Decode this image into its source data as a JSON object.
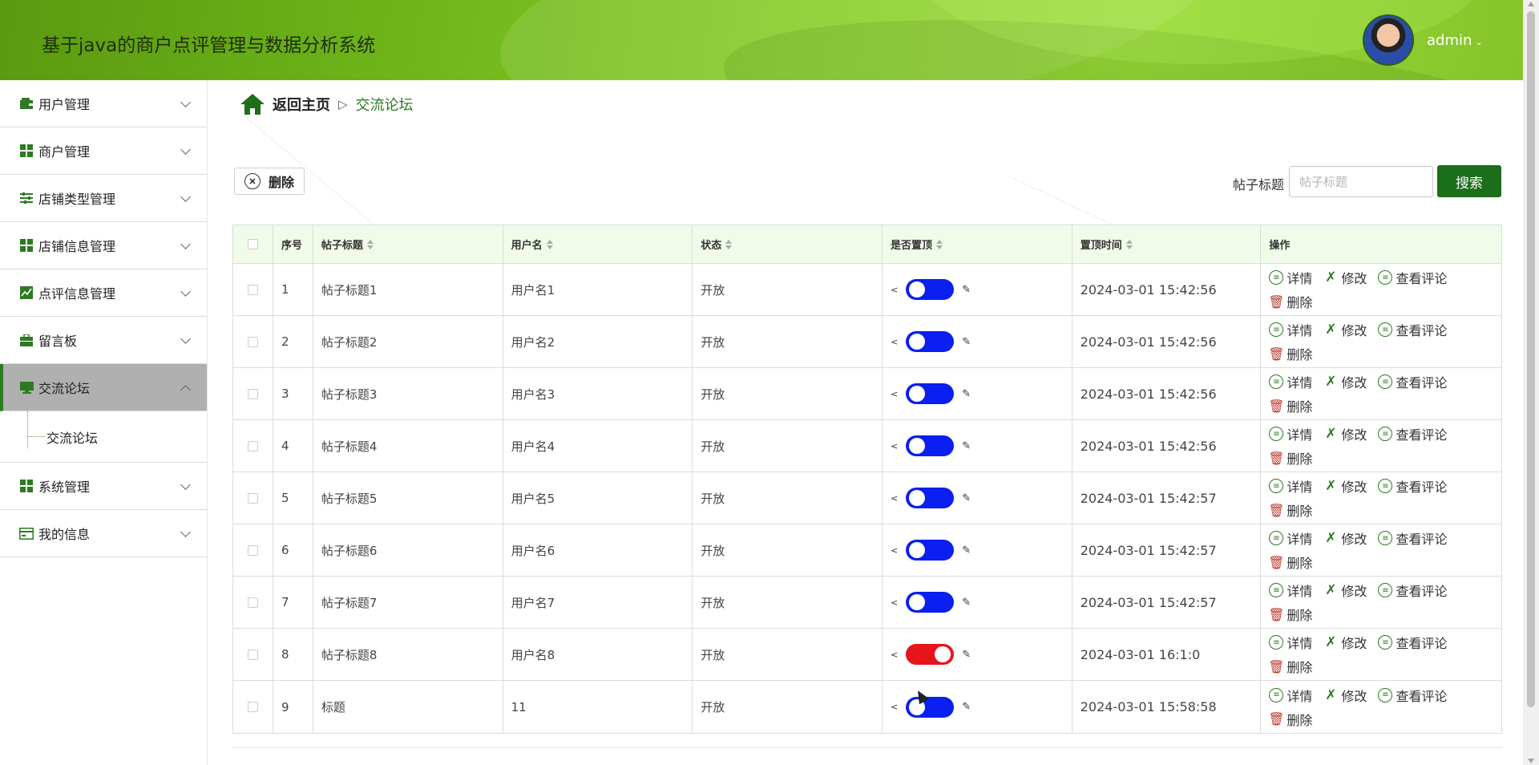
{
  "header": {
    "title": "基于java的商户点评管理与数据分析系统",
    "user": "admin",
    "accent": "#6db319"
  },
  "sidebar": {
    "items": [
      {
        "label": "用户管理",
        "icon": "wallet-icon"
      },
      {
        "label": "商户管理",
        "icon": "grid-icon"
      },
      {
        "label": "店铺类型管理",
        "icon": "sliders-icon"
      },
      {
        "label": "店铺信息管理",
        "icon": "grid-icon"
      },
      {
        "label": "点评信息管理",
        "icon": "chart-icon"
      },
      {
        "label": "留言板",
        "icon": "briefcase-icon"
      },
      {
        "label": "交流论坛",
        "icon": "monitor-icon",
        "active": true
      },
      {
        "label": "系统管理",
        "icon": "grid-icon"
      },
      {
        "label": "我的信息",
        "icon": "card-icon"
      }
    ],
    "sub_item": "交流论坛"
  },
  "breadcrumb": {
    "home": "返回主页",
    "separator": "▷",
    "current": "交流论坛"
  },
  "toolbar": {
    "delete_label": "删除",
    "search_label": "帖子标题",
    "search_placeholder": "帖子标题",
    "search_value": "",
    "search_button": "搜索"
  },
  "table": {
    "headers": [
      "序号",
      "帖子标题",
      "用户名",
      "状态",
      "是否置顶",
      "置顶时间",
      "操作"
    ],
    "rows": [
      {
        "idx": "1",
        "title": "帖子标题1",
        "user": "用户名1",
        "status": "开放",
        "pinned": true,
        "time": "2024-03-01 15:42:56"
      },
      {
        "idx": "2",
        "title": "帖子标题2",
        "user": "用户名2",
        "status": "开放",
        "pinned": true,
        "time": "2024-03-01 15:42:56"
      },
      {
        "idx": "3",
        "title": "帖子标题3",
        "user": "用户名3",
        "status": "开放",
        "pinned": true,
        "time": "2024-03-01 15:42:56"
      },
      {
        "idx": "4",
        "title": "帖子标题4",
        "user": "用户名4",
        "status": "开放",
        "pinned": true,
        "time": "2024-03-01 15:42:56"
      },
      {
        "idx": "5",
        "title": "帖子标题5",
        "user": "用户名5",
        "status": "开放",
        "pinned": true,
        "time": "2024-03-01 15:42:57"
      },
      {
        "idx": "6",
        "title": "帖子标题6",
        "user": "用户名6",
        "status": "开放",
        "pinned": true,
        "time": "2024-03-01 15:42:57"
      },
      {
        "idx": "7",
        "title": "帖子标题7",
        "user": "用户名7",
        "status": "开放",
        "pinned": true,
        "time": "2024-03-01 15:42:57"
      },
      {
        "idx": "8",
        "title": "帖子标题8",
        "user": "用户名8",
        "status": "开放",
        "pinned": false,
        "time": "2024-03-01 16:1:0"
      },
      {
        "idx": "9",
        "title": "标题",
        "user": "11",
        "status": "开放",
        "pinned": true,
        "time": "2024-03-01 15:58:58"
      }
    ],
    "ops": {
      "detail": "详情",
      "edit": "修改",
      "comments": "查看评论",
      "delete": "删除"
    },
    "toggle_on_color": "#0a1ff0",
    "toggle_off_color": "#e8141c"
  }
}
